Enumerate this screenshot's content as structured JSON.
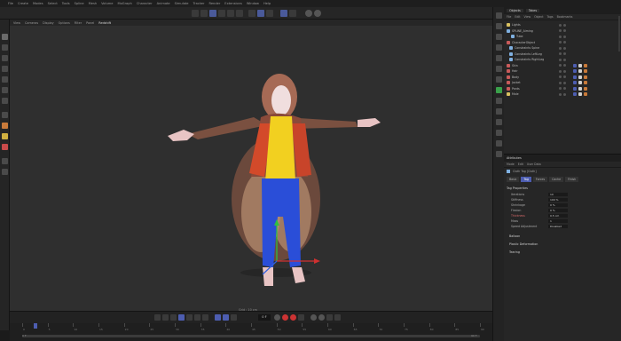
{
  "menubar": [
    "File",
    "Create",
    "Modes",
    "Select",
    "Tools",
    "Spline",
    "Mesh",
    "Volume",
    "MoGraph",
    "Character",
    "Animate",
    "Simulate",
    "Tracker",
    "Render",
    "Extensions",
    "Window",
    "Help"
  ],
  "viewport": {
    "menu": [
      "View",
      "Cameras",
      "Display",
      "Options",
      "Filter",
      "Panel",
      "Redshift"
    ],
    "active_menu": "Redshift",
    "grid_label": "Grid : 10 cm"
  },
  "timeline": {
    "current_frame": "0 F",
    "ruler_labels": [
      "0",
      "5",
      "10",
      "15",
      "20",
      "25",
      "30",
      "35",
      "40",
      "45",
      "50",
      "55",
      "60",
      "65",
      "70",
      "75",
      "80",
      "85",
      "90"
    ],
    "start": "0 F",
    "end": "90 F"
  },
  "objects_panel": {
    "tabs": [
      "Objects",
      "Takes"
    ],
    "menu": [
      "File",
      "Edit",
      "View",
      "Object",
      "Tags",
      "Bookmarks"
    ],
    "items": [
      {
        "label": "Lights",
        "color": "#d8c060"
      },
      {
        "label": "SPLINE_Aiming",
        "color": "#7fb0e0"
      },
      {
        "label": "Tube",
        "color": "#7fb0e0"
      },
      {
        "label": "CharacterObject",
        "color": "#c85a5a"
      },
      {
        "label": "Constraints Spine",
        "color": "#7fb0e0"
      },
      {
        "label": "Constraints LeftLeg",
        "color": "#7fb0e0"
      },
      {
        "label": "Constraints RightLeg",
        "color": "#7fb0e0"
      },
      {
        "label": "Skin",
        "color": "#c85a5a"
      },
      {
        "label": "Hair",
        "color": "#c85a5a"
      },
      {
        "label": "Body",
        "color": "#c85a5a"
      },
      {
        "label": "Jacket",
        "color": "#c85a5a"
      },
      {
        "label": "Pants",
        "color": "#c85a5a"
      },
      {
        "label": "Male",
        "color": "#d8c060"
      }
    ]
  },
  "attributes_panel": {
    "title": "Attributes",
    "subtitle": "Cloth Tag [Cloth]",
    "menu": [
      "Mode",
      "Edit",
      "User Data"
    ],
    "tabs": [
      "Basic",
      "Tag",
      "Forces",
      "Cache",
      "Finish"
    ],
    "active_tab": "Tag",
    "section": "Tag Properties",
    "props": [
      {
        "name": "Iterations",
        "value": "10",
        "red": false
      },
      {
        "name": "Stiffness",
        "value": "100 %",
        "red": false
      },
      {
        "name": "Shrinkage",
        "value": "0 %",
        "red": false
      },
      {
        "name": "Flexion",
        "value": "0 %",
        "red": false
      },
      {
        "name": "Thickness",
        "value": "0.5 cm",
        "red": true
      },
      {
        "name": "Mass",
        "value": "1",
        "red": false
      }
    ],
    "extra_prop_name": "Speed Adjustment",
    "extra_prop_value": "Disabled",
    "collapsibles": [
      "Balloon",
      "Plastic Deformation",
      "Tearing"
    ]
  }
}
